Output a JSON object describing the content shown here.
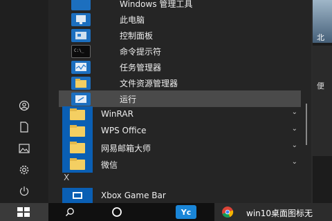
{
  "submenu": [
    {
      "label": "Windows 管理工具"
    },
    {
      "label": "此电脑"
    },
    {
      "label": "控制面板"
    },
    {
      "label": "命令提示符"
    },
    {
      "label": "任务管理器"
    },
    {
      "label": "文件资源管理器"
    },
    {
      "label": "运行"
    }
  ],
  "folders": [
    {
      "label": "WinRAR"
    },
    {
      "label": "WPS Office"
    },
    {
      "label": "网易邮箱大师"
    },
    {
      "label": "微信"
    }
  ],
  "section_letter": "X",
  "xbox_label": "Xbox Game Bar",
  "tiles": {
    "photo_text": "北",
    "text": "便"
  },
  "taskbar": {
    "yc_label": "Yc",
    "chrome_label": "win10桌面图标无"
  },
  "colors": {
    "accent": "#0a5fb4",
    "folder": "#f4cf62"
  }
}
